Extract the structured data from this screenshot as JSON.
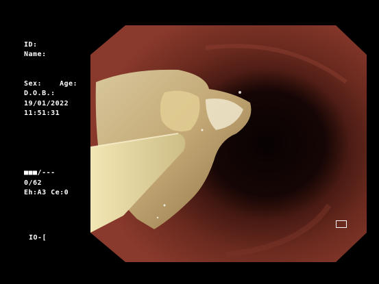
{
  "patient": {
    "id_label": "ID:",
    "name_label": "Name:",
    "sex_label": "Sex:",
    "age_label": "Age:",
    "dob_label": "D.O.B.:",
    "date": "19/01/2022",
    "time": "11:51:31"
  },
  "status": {
    "level": "■■■/---",
    "counter": "0/62",
    "enhancement": "Eh:A3 Ce:0"
  },
  "io_indicator": "IO-[",
  "icons": {
    "monitor": "monitor-icon"
  },
  "colors": {
    "background": "#000000",
    "text": "#ffffff",
    "mucosa": "#7a2f24",
    "lumen": "#0d0303"
  }
}
